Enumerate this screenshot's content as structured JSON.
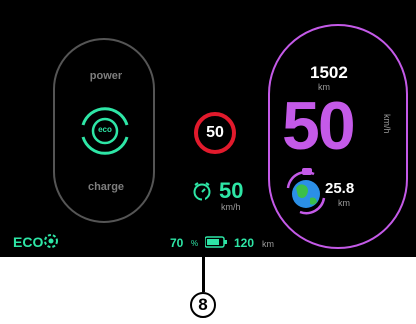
{
  "colors": {
    "accent_green": "#2ee6a6",
    "speed_purple": "#c45ae8",
    "limit_red": "#e21a2c",
    "label_grey": "#7d7d7d"
  },
  "eco_pod": {
    "power_label": "power",
    "eco_badge": "eco",
    "charge_label": "charge"
  },
  "speed_limit": {
    "value": "50"
  },
  "cruise": {
    "icon": "speed-limiter-icon",
    "value": "50",
    "unit": "km/h"
  },
  "speed_pod": {
    "odometer_value": "1502",
    "odometer_unit": "km",
    "speed_value": "50",
    "speed_unit": "km/h",
    "range_icon": "globe-icon",
    "range_value": "25.8",
    "range_unit": "km"
  },
  "bottom_bar": {
    "eco_mode": "ECO",
    "battery_percent": "70",
    "battery_percent_symbol": "%",
    "battery_icon": "battery-icon",
    "range_value": "120",
    "range_unit": "km"
  },
  "callout": {
    "label": "8"
  }
}
